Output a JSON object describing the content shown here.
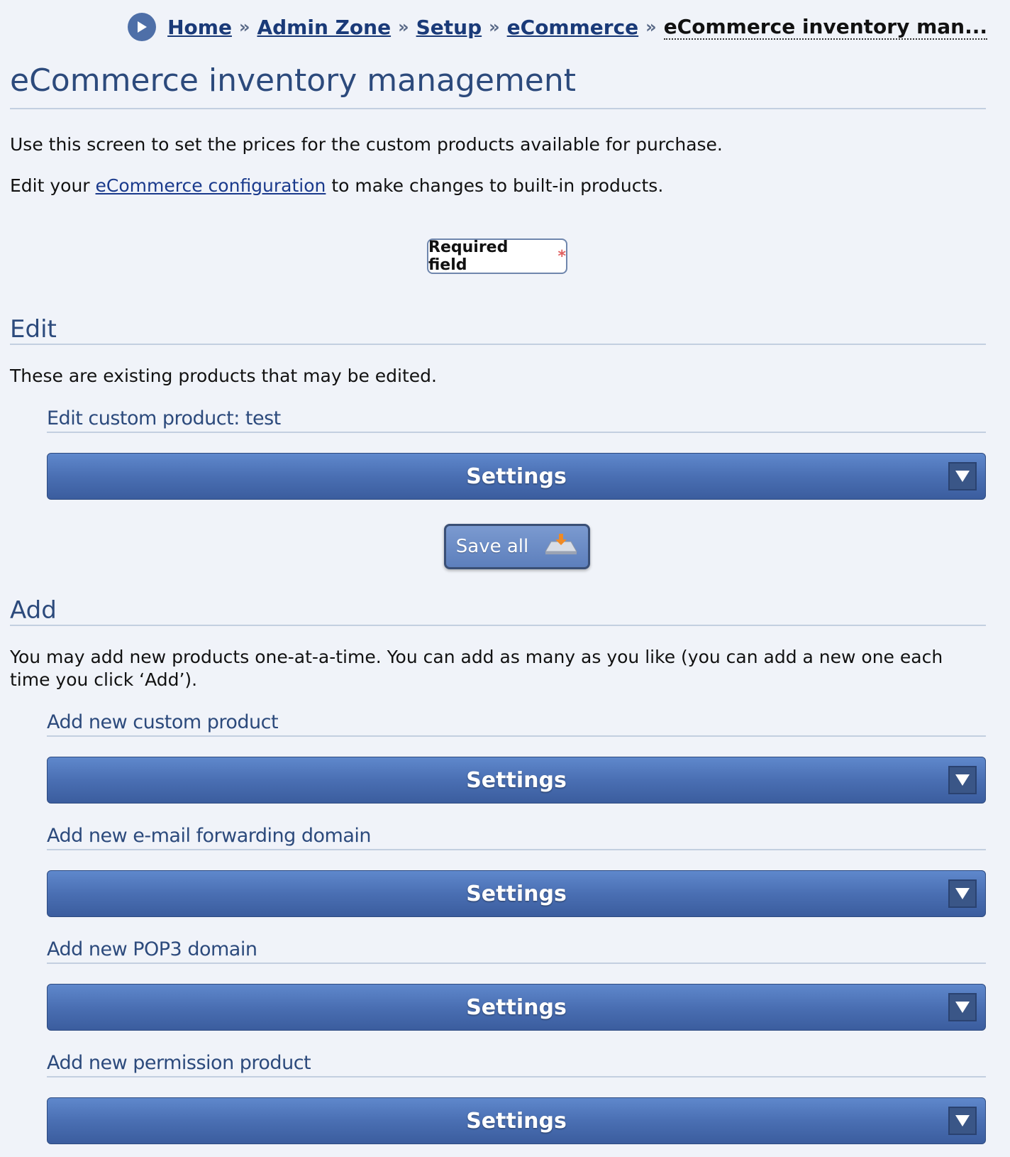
{
  "breadcrumb": {
    "items": [
      "Home",
      "Admin Zone",
      "Setup",
      "eCommerce"
    ],
    "separator": "»",
    "current": "eCommerce inventory man..."
  },
  "page_title": "eCommerce inventory management",
  "intro": {
    "line1": "Use this screen to set the prices for the custom products available for purchase.",
    "line2_prefix": "Edit your ",
    "line2_link": "eCommerce configuration",
    "line2_suffix": " to make changes to built-in products."
  },
  "required_field": {
    "label": "Required field",
    "star": "*"
  },
  "edit_section": {
    "heading": "Edit",
    "description": "These are existing products that may be edited.",
    "items": [
      {
        "title": "Edit custom product: test",
        "settings_label": "Settings"
      }
    ]
  },
  "save_all_label": "Save all",
  "add_section": {
    "heading": "Add",
    "description": "You may add new products one-at-a-time. You can add as many as you like (you can add a new one each time you click ‘Add’).",
    "items": [
      {
        "title": "Add new custom product",
        "settings_label": "Settings"
      },
      {
        "title": "Add new e-mail forwarding domain",
        "settings_label": "Settings"
      },
      {
        "title": "Add new POP3 domain",
        "settings_label": "Settings"
      },
      {
        "title": "Add new permission product",
        "settings_label": "Settings"
      }
    ]
  },
  "colors": {
    "background": "#f0f3f9",
    "heading": "#2c4a7c",
    "bar": "#4a6fb3",
    "link": "#1a3a8c",
    "required_star": "#e06060"
  }
}
